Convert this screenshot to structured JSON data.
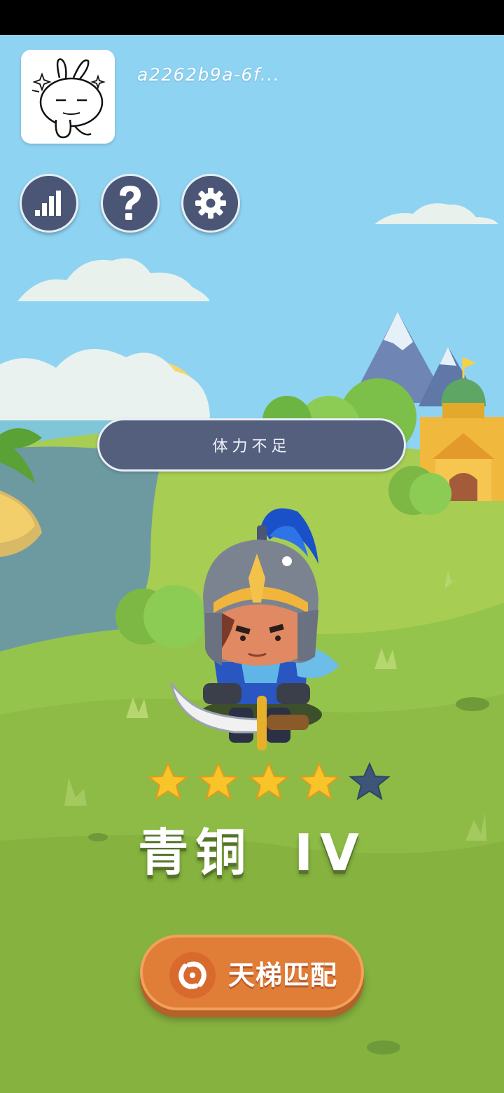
{
  "player": {
    "username": "a2262b9a-6f..."
  },
  "toolbar": {
    "buttons": [
      {
        "id": "leaderboard",
        "icon": "bar-chart-icon"
      },
      {
        "id": "help",
        "icon": "question-mark-icon"
      },
      {
        "id": "settings",
        "icon": "gear-icon"
      }
    ]
  },
  "toast": {
    "message": "体力不足"
  },
  "rank": {
    "stars_filled": 4,
    "stars_total": 5,
    "title": "青铜 IV"
  },
  "match_button": {
    "label": "天梯匹配",
    "icon": "swirl-icon"
  },
  "colors": {
    "sky": "#8fd3f2",
    "grass": "#8cbf45",
    "button_navy": "#4b5676",
    "match_orange": "#e07e38",
    "star_gold": "#f7c52a",
    "star_empty": "#3d5577"
  }
}
